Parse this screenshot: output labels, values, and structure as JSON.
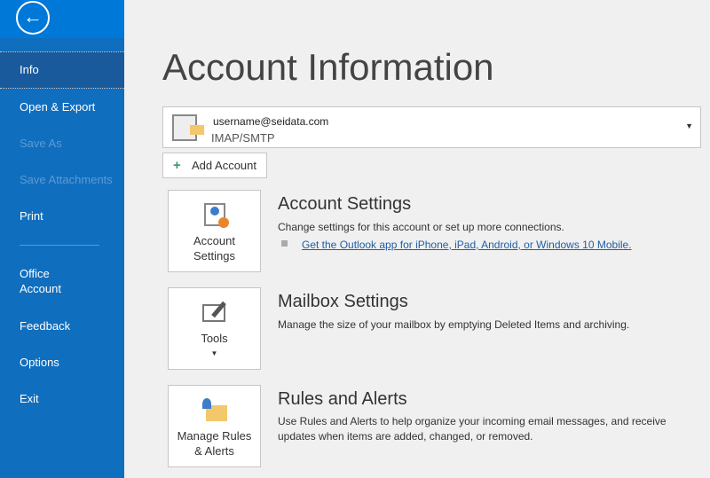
{
  "sidebar": {
    "items": [
      {
        "label": "Info"
      },
      {
        "label": "Open & Export"
      },
      {
        "label": "Save As"
      },
      {
        "label": "Save Attachments"
      },
      {
        "label": "Print"
      },
      {
        "label": "Office\nAccount"
      },
      {
        "label": "Feedback"
      },
      {
        "label": "Options"
      },
      {
        "label": "Exit"
      }
    ]
  },
  "page": {
    "title": "Account Information"
  },
  "account": {
    "email": "username@seidata.com",
    "protocol": "IMAP/SMTP",
    "add_label": "Add Account"
  },
  "sections": [
    {
      "button": "Account Settings",
      "heading": "Account Settings",
      "desc": "Change settings for this account or set up more connections.",
      "link": "Get the Outlook app for iPhone, iPad, Android, or Windows 10 Mobile."
    },
    {
      "button": "Tools",
      "heading": "Mailbox Settings",
      "desc": "Manage the size of your mailbox by emptying Deleted Items and archiving."
    },
    {
      "button": "Manage Rules & Alerts",
      "heading": "Rules and Alerts",
      "desc": "Use Rules and Alerts to help organize your incoming email messages, and receive updates when items are added, changed, or removed."
    }
  ]
}
